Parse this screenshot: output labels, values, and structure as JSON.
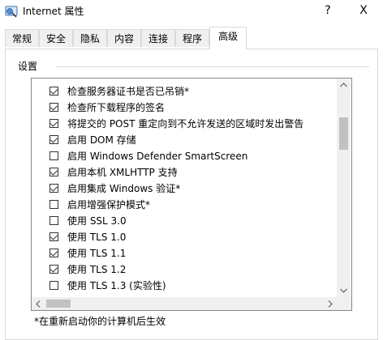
{
  "window": {
    "title": "Internet 属性",
    "help_label": "?",
    "close_label": "X"
  },
  "tabs": [
    {
      "label": "常规"
    },
    {
      "label": "安全"
    },
    {
      "label": "隐私"
    },
    {
      "label": "内容"
    },
    {
      "label": "连接"
    },
    {
      "label": "程序"
    },
    {
      "label": "高级",
      "active": true
    }
  ],
  "settings": {
    "group_label": "设置",
    "items": [
      {
        "label": "检查服务器证书是否已吊销*",
        "checked": true
      },
      {
        "label": "检查所下载程序的签名",
        "checked": true
      },
      {
        "label": "将提交的 POST 重定向到不允许发送的区域时发出警告",
        "checked": true
      },
      {
        "label": "启用 DOM 存储",
        "checked": true
      },
      {
        "label": "启用 Windows Defender SmartScreen",
        "checked": false
      },
      {
        "label": "启用本机 XMLHTTP 支持",
        "checked": true
      },
      {
        "label": "启用集成 Windows 验证*",
        "checked": true
      },
      {
        "label": "启用增强保护模式*",
        "checked": false
      },
      {
        "label": "使用 SSL 3.0",
        "checked": false
      },
      {
        "label": "使用 TLS 1.0",
        "checked": true
      },
      {
        "label": "使用 TLS 1.1",
        "checked": true
      },
      {
        "label": "使用 TLS 1.2",
        "checked": true
      },
      {
        "label": "使用 TLS 1.3 (实验性)",
        "checked": false
      }
    ],
    "footnote": "*在重新启动你的计算机后生效"
  }
}
